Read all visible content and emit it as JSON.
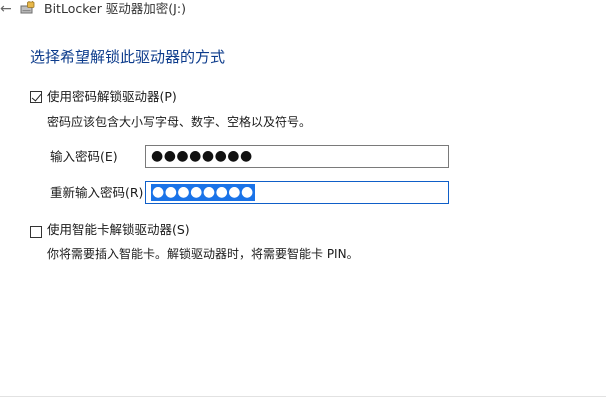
{
  "window": {
    "title": "BitLocker 驱动器加密(J:)",
    "back_icon": "←",
    "drive_icon": "drive-lock-icon"
  },
  "heading": "选择希望解锁此驱动器的方式",
  "password_option": {
    "checked": true,
    "label": "使用密码解锁驱动器(P)",
    "hint": "密码应该包含大小写字母、数字、空格以及符号。",
    "enter_label": "输入密码(E)",
    "enter_value": "●●●●●●●●",
    "reenter_label": "重新输入密码(R)",
    "reenter_value": "●●●●●●●●"
  },
  "smartcard_option": {
    "checked": false,
    "label": "使用智能卡解锁驱动器(S)",
    "hint": "你将需要插入智能卡。解锁驱动器时，将需要智能卡 PIN。"
  },
  "colors": {
    "heading": "#0d3c8c",
    "focus_border": "#0f5fc8",
    "selection": "#1a73e8"
  }
}
